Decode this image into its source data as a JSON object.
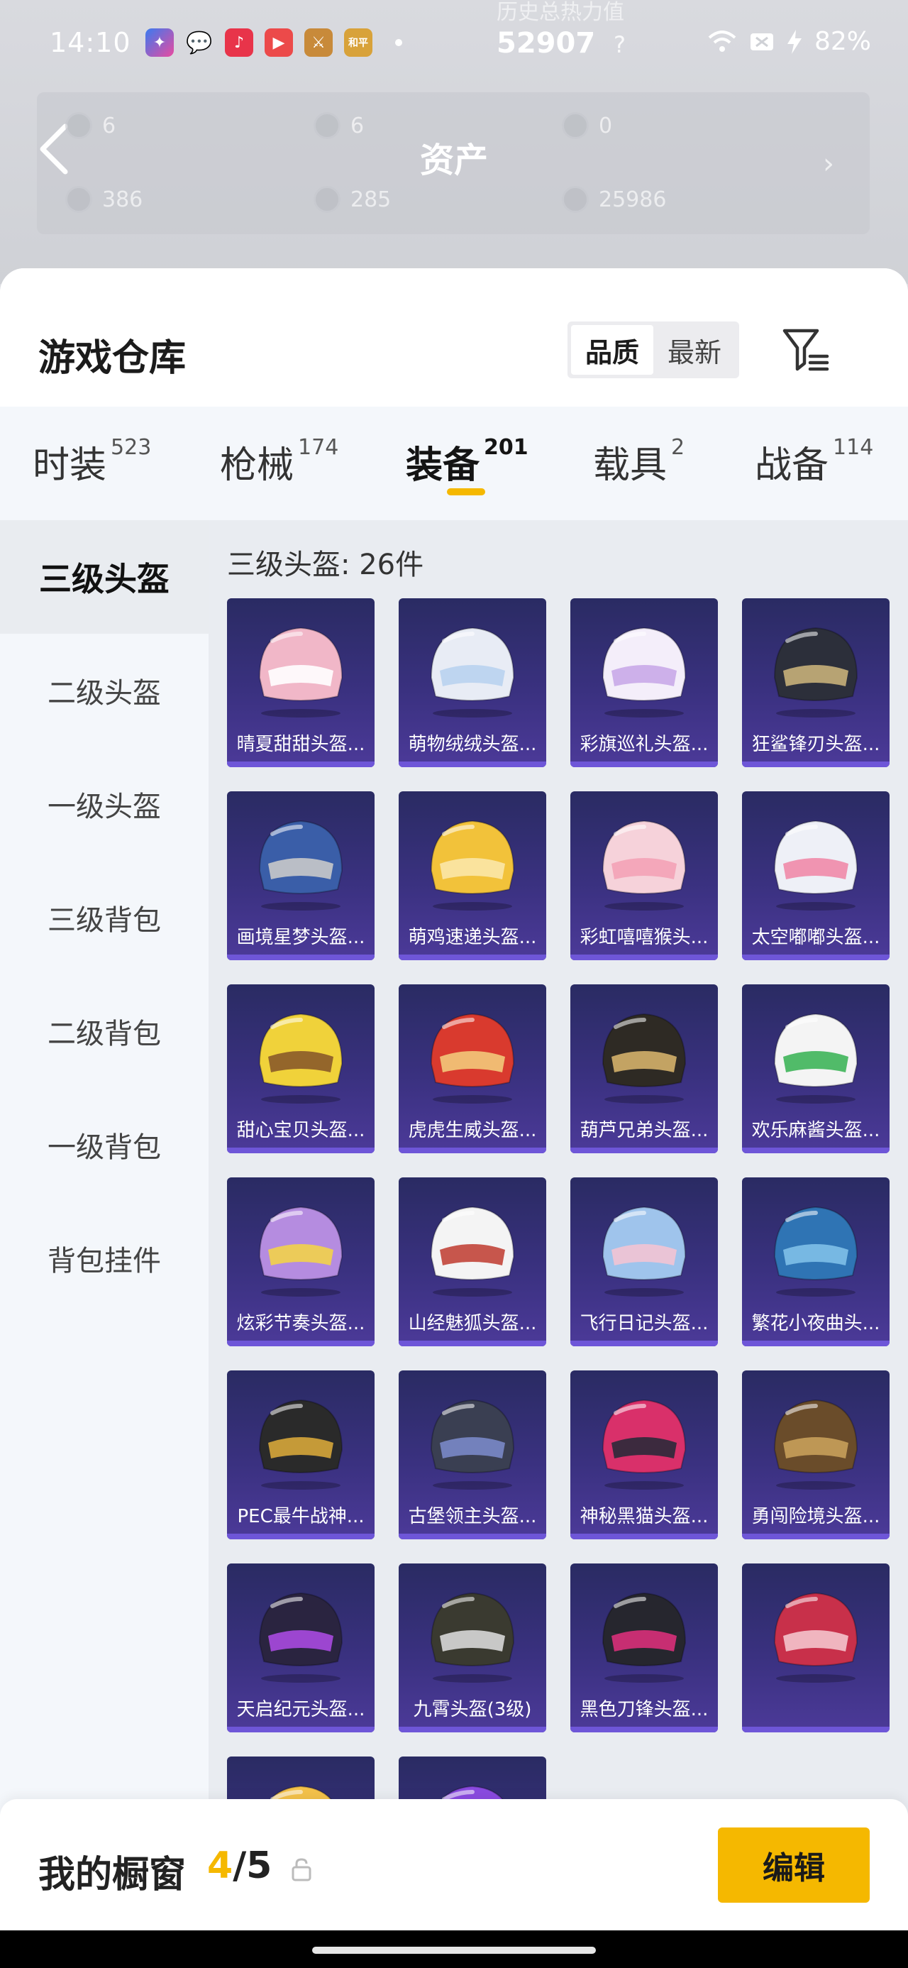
{
  "status_bar": {
    "time": "14:10",
    "center_text": "52907",
    "faded_text": "历史总热力值",
    "battery": "82%"
  },
  "assets_panel": {
    "title": "资产",
    "items": [
      "6",
      "6",
      "0",
      "386",
      "285",
      "25986"
    ]
  },
  "sheet": {
    "title": "游戏仓库",
    "sort_options": [
      "品质",
      "最新"
    ],
    "active_sort": "品质"
  },
  "tabs": [
    {
      "label": "时装",
      "count": "523"
    },
    {
      "label": "枪械",
      "count": "174"
    },
    {
      "label": "装备",
      "count": "201"
    },
    {
      "label": "载具",
      "count": "2"
    },
    {
      "label": "战备",
      "count": "114"
    }
  ],
  "active_tab": "装备",
  "sidebar": {
    "items": [
      "三级头盔",
      "二级头盔",
      "一级头盔",
      "三级背包",
      "二级背包",
      "一级背包",
      "背包挂件"
    ],
    "active": "三级头盔"
  },
  "content": {
    "count_label": "三级头盔: 26件",
    "items": [
      {
        "name": "晴夏甜甜头盔...",
        "color": "#f1b7c8",
        "accent": "#ffffff"
      },
      {
        "name": "萌物绒绒头盔...",
        "color": "#e8ecf5",
        "accent": "#b9d3f0"
      },
      {
        "name": "彩旗巡礼头盔...",
        "color": "#f4eefa",
        "accent": "#c9a8e8"
      },
      {
        "name": "狂鲨锋刃头盔...",
        "color": "#2c2f3a",
        "accent": "#c7b07a"
      },
      {
        "name": "画境星梦头盔...",
        "color": "#3a5ea8",
        "accent": "#c9c9c9"
      },
      {
        "name": "萌鸡速递头盔...",
        "color": "#f2c23a",
        "accent": "#fbe7a8"
      },
      {
        "name": "彩虹嘻嘻猴头...",
        "color": "#f6d2da",
        "accent": "#f4a2b6"
      },
      {
        "name": "太空嘟嘟头盔...",
        "color": "#eef0f7",
        "accent": "#f08aa9"
      },
      {
        "name": "甜心宝贝头盔...",
        "color": "#f0d23a",
        "accent": "#8a5a2a"
      },
      {
        "name": "虎虎生威头盔...",
        "color": "#d93a2e",
        "accent": "#f2c97a"
      },
      {
        "name": "葫芦兄弟头盔...",
        "color": "#2e2a24",
        "accent": "#d4b06a"
      },
      {
        "name": "欢乐麻酱头盔...",
        "color": "#f4f4f4",
        "accent": "#3fb55a"
      },
      {
        "name": "炫彩节奏头盔...",
        "color": "#b58ce0",
        "accent": "#f2d24a"
      },
      {
        "name": "山经魅狐头盔...",
        "color": "#f4f4f4",
        "accent": "#c2453a"
      },
      {
        "name": "飞行日记头盔...",
        "color": "#9fc4ec",
        "accent": "#f2c4d4"
      },
      {
        "name": "繁花小夜曲头...",
        "color": "#2f74b4",
        "accent": "#7fc0e8"
      },
      {
        "name": "PEC最牛战神...",
        "color": "#2a2a2a",
        "accent": "#d6a63a"
      },
      {
        "name": "古堡领主头盔...",
        "color": "#3a3f52",
        "accent": "#7a88c8"
      },
      {
        "name": "神秘黑猫头盔...",
        "color": "#d9306a",
        "accent": "#2a2a3a"
      },
      {
        "name": "勇闯险境头盔...",
        "color": "#6a4c2a",
        "accent": "#c8a05a"
      },
      {
        "name": "天启纪元头盔...",
        "color": "#2a2440",
        "accent": "#a84ae0"
      },
      {
        "name": "九霄头盔(3级)",
        "color": "#3a3a30",
        "accent": "#d8d8d8"
      },
      {
        "name": "黑色刀锋头盔...",
        "color": "#26262e",
        "accent": "#d9307a"
      },
      {
        "name": "",
        "color": "#c8304a",
        "accent": "#f4c4cc"
      },
      {
        "name": "",
        "color": "#f4c24a",
        "accent": "#7ab8ec"
      },
      {
        "name": "",
        "color": "#8a4ae0",
        "accent": "#c89af0"
      }
    ]
  },
  "bottom_bar": {
    "title": "我的橱窗",
    "count_current": "4",
    "count_total": "/5",
    "edit_label": "编辑"
  },
  "colors": {
    "accent": "#f5b800",
    "card_top": "#2a2b63",
    "card_bottom": "#4c3a99"
  }
}
